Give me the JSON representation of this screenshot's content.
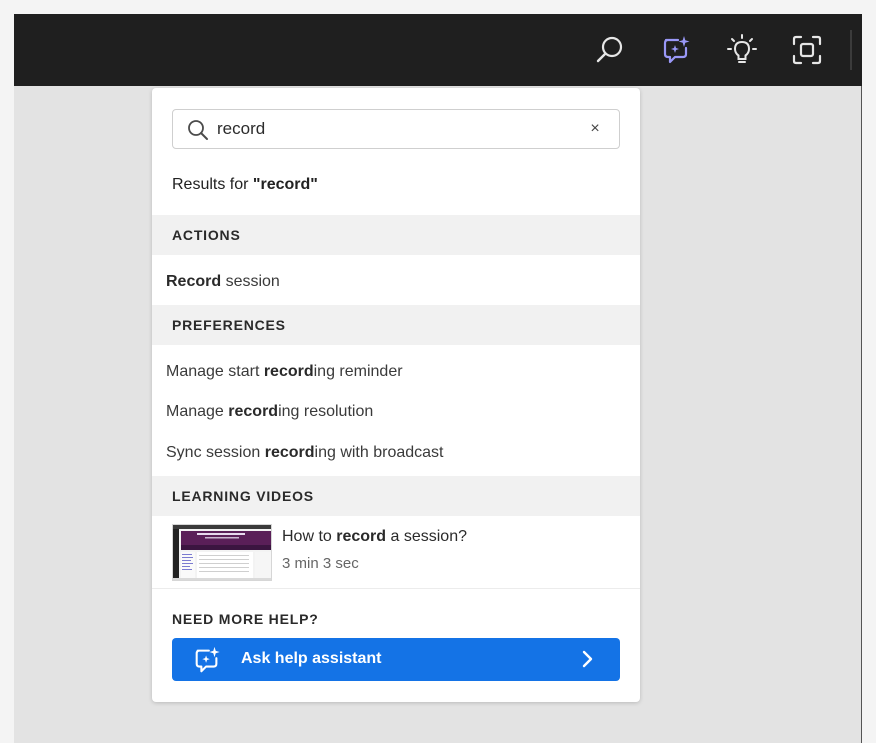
{
  "toolbar": {
    "icons": [
      "search-icon",
      "help-assistant-icon",
      "lightbulb-icon",
      "focus-frame-icon"
    ],
    "accent_color": "#8f8ef5"
  },
  "search": {
    "value": "record",
    "placeholder": "",
    "clear_glyph": "×"
  },
  "results_header": {
    "prefix": "Results for ",
    "query_quoted": "\"record\""
  },
  "sections": {
    "actions": {
      "title": "ACTIONS",
      "items": [
        {
          "pre": "",
          "bold": "Record",
          "post": " session"
        }
      ]
    },
    "preferences": {
      "title": "PREFERENCES",
      "items": [
        {
          "pre": "Manage start ",
          "bold": "record",
          "post": "ing reminder"
        },
        {
          "pre": "Manage ",
          "bold": "record",
          "post": "ing resolution"
        },
        {
          "pre": "Sync session ",
          "bold": "record",
          "post": "ing with broadcast"
        }
      ]
    },
    "learning_videos": {
      "title": "LEARNING VIDEOS",
      "items": [
        {
          "pre": "How to ",
          "bold": "record",
          "post": " a session?",
          "duration": "3 min 3 sec"
        }
      ]
    }
  },
  "help": {
    "label": "NEED MORE HELP?",
    "button_label": "Ask help assistant",
    "button_color": "#1473e6"
  }
}
